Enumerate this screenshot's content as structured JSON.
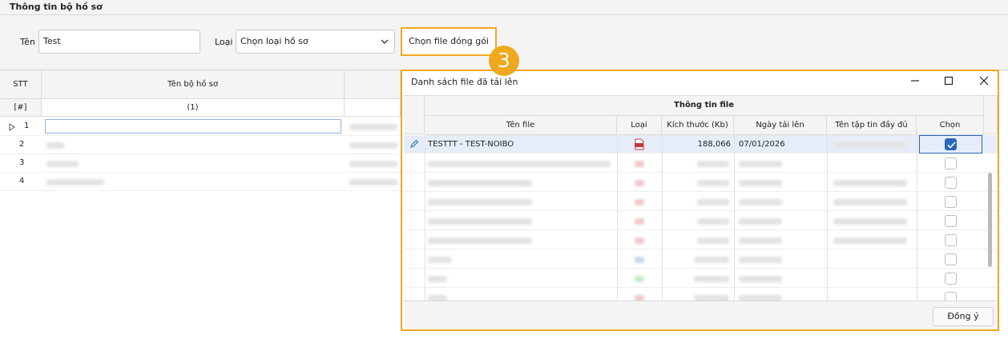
{
  "section": {
    "title": "Thông tin bộ hồ sơ"
  },
  "form": {
    "name_label": "Tên",
    "name_value": "Test",
    "type_label": "Loại",
    "type_value": "Chọn loại hồ sơ",
    "pack_button": "Chọn file đóng gói"
  },
  "step_badge": "3",
  "grid": {
    "col_stt": "STT",
    "col_name": "Tên bộ hồ sơ",
    "sub_stt": "[#]",
    "sub_name": "(1)",
    "rows": [
      "1",
      "2",
      "3",
      "4"
    ]
  },
  "dialog": {
    "title": "Danh sách file đã tải lên",
    "group_header": "Thông tin file",
    "columns": {
      "file_name": "Tên file",
      "type": "Loại",
      "size": "Kích thước (Kb)",
      "date": "Ngày tải lên",
      "full_name": "Tên tập tin đầy đủ",
      "choose": "Chọn"
    },
    "first_row": {
      "file_name": "TESTTT - TEST-NOIBO",
      "size": "188,066",
      "date": "07/01/2026",
      "checked": true
    },
    "ok_button": "Đồng ý"
  },
  "colors": {
    "accent": "#f0a81c",
    "selection": "#e6edf9",
    "check": "#2b67b8"
  }
}
